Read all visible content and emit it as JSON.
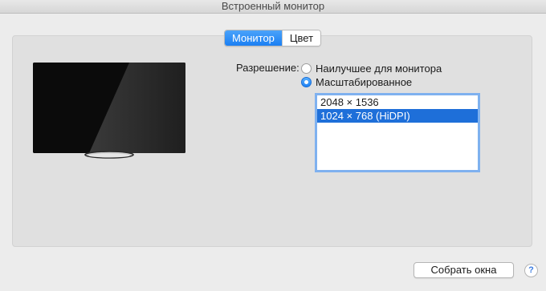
{
  "window": {
    "title": "Встроенный монитор"
  },
  "tabs": [
    {
      "label": "Монитор",
      "active": true
    },
    {
      "label": "Цвет",
      "active": false
    }
  ],
  "resolution": {
    "label": "Разрешение:",
    "options": [
      {
        "label": "Наилучшее для монитора",
        "selected": false
      },
      {
        "label": "Масштабированное",
        "selected": true
      }
    ],
    "scaled_list": [
      {
        "label": "2048 × 1536",
        "selected": false
      },
      {
        "label": "1024 × 768 (HiDPI)",
        "selected": true
      }
    ]
  },
  "footer": {
    "gather_button": "Собрать окна",
    "help_icon": "?"
  },
  "colors": {
    "accent": "#1b7ff3",
    "selection": "#1e6fd9"
  },
  "icons": {
    "help": "help-icon",
    "monitor": "monitor-icon"
  }
}
